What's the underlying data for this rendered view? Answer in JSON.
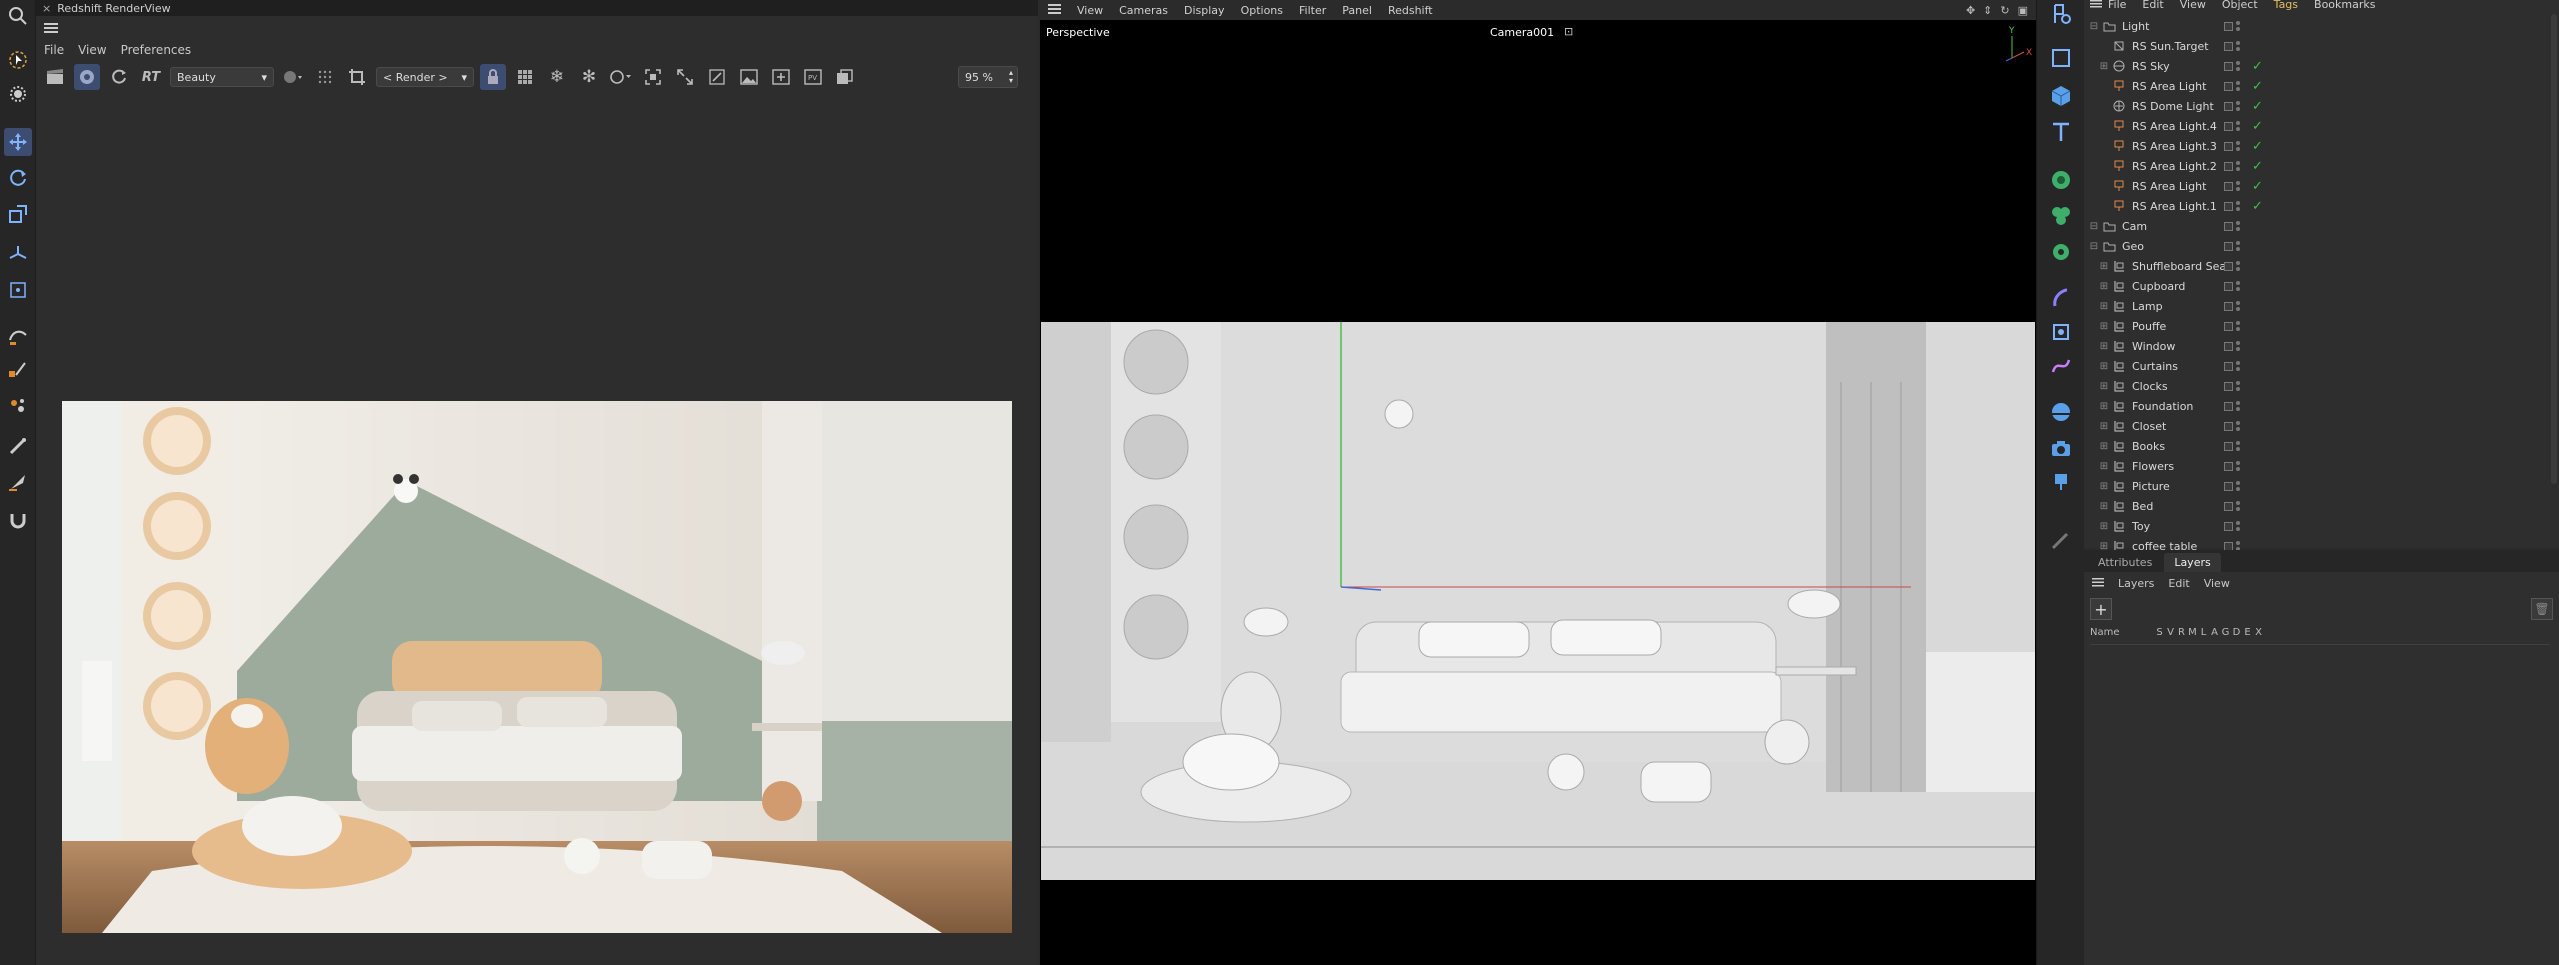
{
  "render_view": {
    "title": "Redshift RenderView",
    "close_glyph": "×",
    "menu": [
      "File",
      "View",
      "Preferences"
    ],
    "rt_label": "RT",
    "aov_select": "Beauty",
    "render_select": "< Render >",
    "zoom": "95 %"
  },
  "viewport": {
    "menu": [
      "View",
      "Cameras",
      "Display",
      "Options",
      "Filter",
      "Panel",
      "Redshift"
    ],
    "view_name": "Perspective",
    "camera_name": "Camera001",
    "axis": {
      "y": "Y",
      "x": "X"
    }
  },
  "object_manager": {
    "menu": [
      "File",
      "Edit",
      "View",
      "Object",
      "Tags",
      "Bookmarks"
    ],
    "rows": [
      {
        "name": "Light",
        "level": 0,
        "type": "null",
        "checked": false
      },
      {
        "name": "RS Sun.Target",
        "level": 1,
        "type": "target",
        "checked": false
      },
      {
        "name": "RS Sky",
        "level": 1,
        "type": "sky",
        "checked": true
      },
      {
        "name": "RS Area Light",
        "level": 1,
        "type": "light",
        "checked": true
      },
      {
        "name": "RS Dome Light",
        "level": 1,
        "type": "dome",
        "checked": true
      },
      {
        "name": "RS Area Light.4",
        "level": 1,
        "type": "light",
        "checked": true
      },
      {
        "name": "RS Area Light.3",
        "level": 1,
        "type": "light",
        "checked": true
      },
      {
        "name": "RS Area Light.2",
        "level": 1,
        "type": "light",
        "checked": true
      },
      {
        "name": "RS Area Light",
        "level": 1,
        "type": "light",
        "checked": true
      },
      {
        "name": "RS Area Light.1",
        "level": 1,
        "type": "light",
        "checked": true
      },
      {
        "name": "Cam",
        "level": 0,
        "type": "null",
        "checked": false
      },
      {
        "name": "Geo",
        "level": 0,
        "type": "null",
        "checked": false
      },
      {
        "name": "Shuffleboard Seat",
        "level": 1,
        "type": "geo",
        "checked": false
      },
      {
        "name": "Cupboard",
        "level": 1,
        "type": "geo",
        "checked": false
      },
      {
        "name": "Lamp",
        "level": 1,
        "type": "geo",
        "checked": false
      },
      {
        "name": "Pouffe",
        "level": 1,
        "type": "geo",
        "checked": false
      },
      {
        "name": "Window",
        "level": 1,
        "type": "geo",
        "checked": false
      },
      {
        "name": "Curtains",
        "level": 1,
        "type": "geo",
        "checked": false
      },
      {
        "name": "Clocks",
        "level": 1,
        "type": "geo",
        "checked": false
      },
      {
        "name": "Foundation",
        "level": 1,
        "type": "geo",
        "checked": false
      },
      {
        "name": "Closet",
        "level": 1,
        "type": "geo",
        "checked": false
      },
      {
        "name": "Books",
        "level": 1,
        "type": "geo",
        "checked": false
      },
      {
        "name": "Flowers",
        "level": 1,
        "type": "geo",
        "checked": false
      },
      {
        "name": "Picture",
        "level": 1,
        "type": "geo",
        "checked": false
      },
      {
        "name": "Bed",
        "level": 1,
        "type": "geo",
        "checked": false
      },
      {
        "name": "Toy",
        "level": 1,
        "type": "geo",
        "checked": false
      },
      {
        "name": "coffee table",
        "level": 1,
        "type": "geo",
        "checked": false
      }
    ]
  },
  "bottom_panel": {
    "tabs": [
      "Attributes",
      "Layers"
    ],
    "active_tab": "Layers",
    "menu": [
      "Layers",
      "Edit",
      "View"
    ],
    "add_glyph": "+",
    "header_name": "Name",
    "header_cols": [
      "S",
      "V",
      "R",
      "M",
      "L",
      "A",
      "G",
      "D",
      "E",
      "X"
    ]
  },
  "colors": {
    "accent": "#3d4d72",
    "check": "#3ec43e",
    "light_icon": "#e08a4a",
    "null_icon": "#b0b0b0"
  }
}
